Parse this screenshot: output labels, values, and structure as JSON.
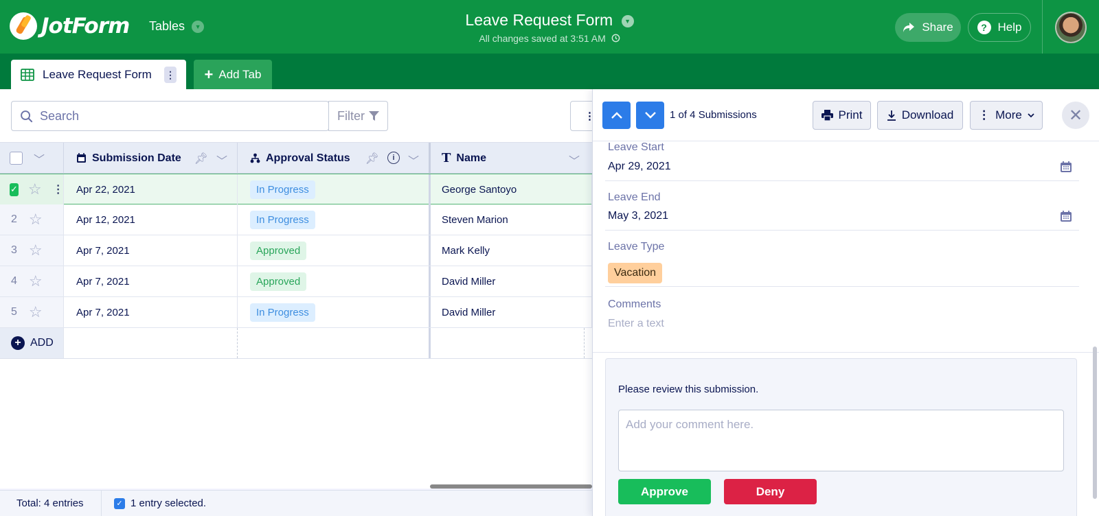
{
  "app": {
    "brand": "JotForm",
    "product": "Tables",
    "form_title": "Leave Request Form",
    "saved_status": "All changes saved at 3:51 AM",
    "share_label": "Share",
    "help_label": "Help"
  },
  "tabs": {
    "active_label": "Leave Request Form",
    "add_tab_label": "Add Tab"
  },
  "toolbar": {
    "search_placeholder": "Search",
    "filter_label": "Filter"
  },
  "table": {
    "columns": {
      "submission_date": "Submission Date",
      "approval_status": "Approval Status",
      "name": "Name"
    },
    "rows": [
      {
        "num": "1",
        "date": "Apr 22, 2021",
        "status": "In Progress",
        "name": "George Santoyo",
        "selected": true
      },
      {
        "num": "2",
        "date": "Apr 12, 2021",
        "status": "In Progress",
        "name": "Steven Marion"
      },
      {
        "num": "3",
        "date": "Apr 7, 2021",
        "status": "Approved",
        "name": "Mark Kelly"
      },
      {
        "num": "4",
        "date": "Apr 7, 2021",
        "status": "Approved",
        "name": "David Miller"
      },
      {
        "num": "5",
        "date": "Apr 7, 2021",
        "status": "In Progress",
        "name": "David Miller"
      }
    ],
    "add_label": "ADD"
  },
  "footer": {
    "total": "Total: 4 entries",
    "selected": "1 entry selected."
  },
  "panel": {
    "count": "1 of 4 Submissions",
    "print_label": "Print",
    "download_label": "Download",
    "more_label": "More",
    "fields": {
      "leave_start_label": "Leave Start",
      "leave_start_value": "Apr 29, 2021",
      "leave_end_label": "Leave End",
      "leave_end_value": "May 3, 2021",
      "leave_type_label": "Leave Type",
      "leave_type_value": "Vacation",
      "comments_label": "Comments",
      "comments_placeholder": "Enter a text"
    },
    "review": {
      "prompt": "Please review this submission.",
      "comment_placeholder": "Add your comment here.",
      "approve_label": "Approve",
      "deny_label": "Deny"
    }
  },
  "colors": {
    "header_green": "#0d9444",
    "tab_green": "#007a3c",
    "primary_blue": "#2c7ce8",
    "approve_green": "#18bd5b",
    "deny_red": "#dc2245",
    "in_progress_bg": "#dceeff",
    "approved_bg": "#dff5e7",
    "vacation_bg": "#ffcf9c"
  }
}
